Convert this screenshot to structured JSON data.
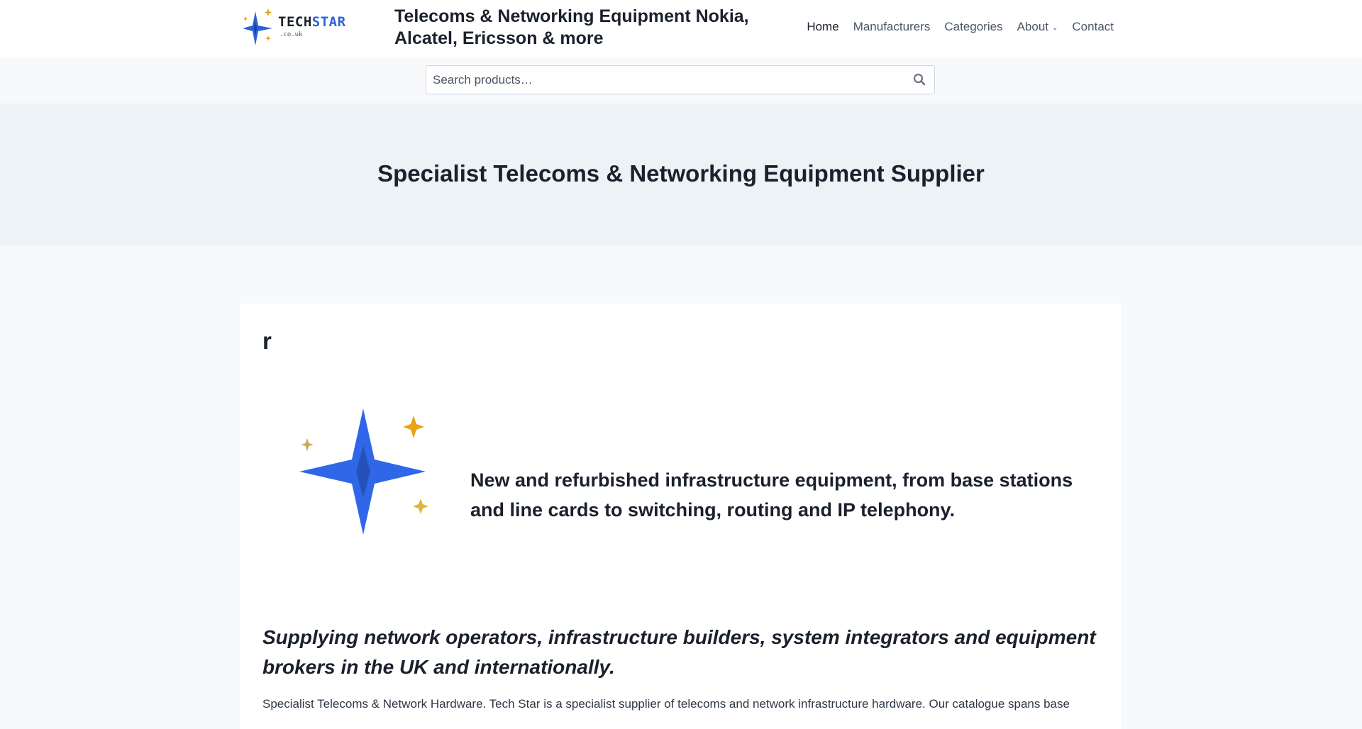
{
  "header": {
    "logo": {
      "name_part1": "TECH",
      "name_part2": "STAR",
      "domain": ".co.uk",
      "icon": "four-point-star-logo"
    },
    "site_title": "Telecoms & Networking Equipment Nokia, Alcatel, Ericsson & more",
    "nav": [
      {
        "label": "Home",
        "active": true
      },
      {
        "label": "Manufacturers"
      },
      {
        "label": "Categories"
      },
      {
        "label": "About",
        "has_dropdown": true
      },
      {
        "label": "Contact"
      }
    ]
  },
  "search": {
    "placeholder": "Search products…",
    "button_icon": "search-icon"
  },
  "hero": {
    "title": "Specialist Telecoms & Networking Equipment Supplier"
  },
  "content": {
    "heading": "r",
    "feature_icon": "sparkle-stars-icon",
    "tagline": "New and refurbished infrastructure equipment, from base stations and line cards to switching, routing and IP telephony.",
    "lead": "Supplying network operators, infrastructure builders, system integrators and equipment brokers in the UK and internationally.",
    "body": "Specialist Telecoms & Network Hardware. Tech Star is a specialist supplier of telecoms and network infrastructure hardware. Our catalogue spans base"
  },
  "colors": {
    "brand_blue": "#2b61d6",
    "star_blue": "#2f67e8",
    "star_dark": "#2452b8",
    "gold": "#e8a317",
    "tan": "#c9aa5c",
    "hero_bg": "#edf2f7"
  }
}
